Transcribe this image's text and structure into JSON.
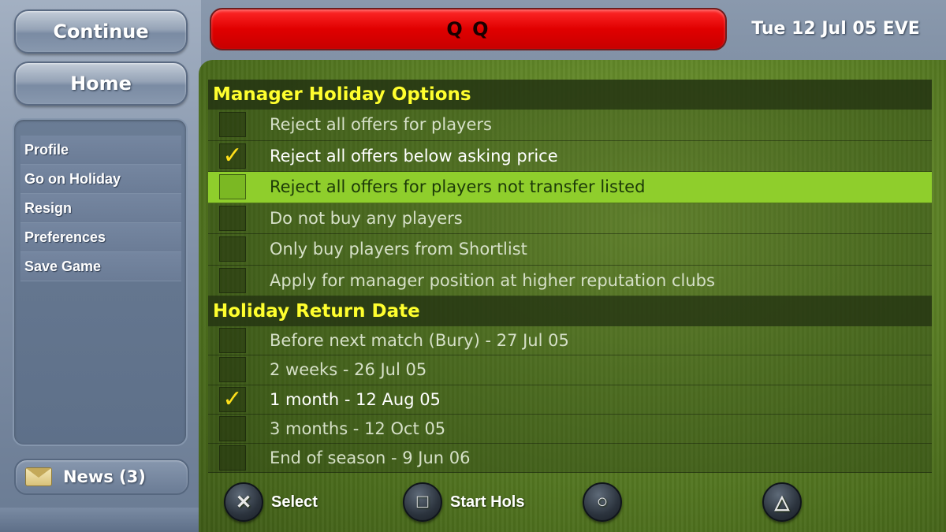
{
  "sidebar": {
    "continue_label": "Continue",
    "home_label": "Home",
    "menu_items": [
      {
        "label": "Profile"
      },
      {
        "label": "Go on Holiday"
      },
      {
        "label": "Resign"
      },
      {
        "label": "Preferences"
      },
      {
        "label": "Save Game"
      }
    ],
    "news_label": "News (3)",
    "news_icon": "envelope-icon"
  },
  "header": {
    "title": "Q Q",
    "title_bar_color": "#e00000",
    "date": "Tue 12 Jul 05 EVE"
  },
  "main": {
    "sections": [
      {
        "title": "Manager Holiday Options",
        "options": [
          {
            "label": "Reject all offers for players",
            "checked": false,
            "highlighted": false
          },
          {
            "label": "Reject all offers below asking price",
            "checked": true,
            "highlighted": false
          },
          {
            "label": "Reject all offers for players not transfer listed",
            "checked": false,
            "highlighted": true
          },
          {
            "label": "Do not buy any players",
            "checked": false,
            "highlighted": false
          },
          {
            "label": "Only buy players from Shortlist",
            "checked": false,
            "highlighted": false
          },
          {
            "label": "Apply for manager position at higher reputation clubs",
            "checked": false,
            "highlighted": false
          }
        ]
      },
      {
        "title": "Holiday Return Date",
        "options": [
          {
            "label": "Before next match (Bury) - 27 Jul 05",
            "checked": false,
            "highlighted": false
          },
          {
            "label": "2 weeks - 26 Jul 05",
            "checked": false,
            "highlighted": false
          },
          {
            "label": "1 month - 12 Aug 05",
            "checked": true,
            "highlighted": false
          },
          {
            "label": "3 months - 12 Oct 05",
            "checked": false,
            "highlighted": false
          },
          {
            "label": "End of season - 9 Jun 06",
            "checked": false,
            "highlighted": false
          }
        ]
      }
    ]
  },
  "controls": {
    "cross": {
      "symbol": "✕",
      "label": "Select",
      "icon": "cross-button-icon"
    },
    "square": {
      "symbol": "□",
      "label": "Start Hols",
      "icon": "square-button-icon"
    },
    "circle": {
      "symbol": "○",
      "label": "",
      "icon": "circle-button-icon"
    },
    "triangle": {
      "symbol": "△",
      "label": "",
      "icon": "triangle-button-icon"
    }
  },
  "colors": {
    "highlight": "#8fce2c",
    "section_title": "#ffff2e",
    "checkmark": "#ffe01a"
  }
}
